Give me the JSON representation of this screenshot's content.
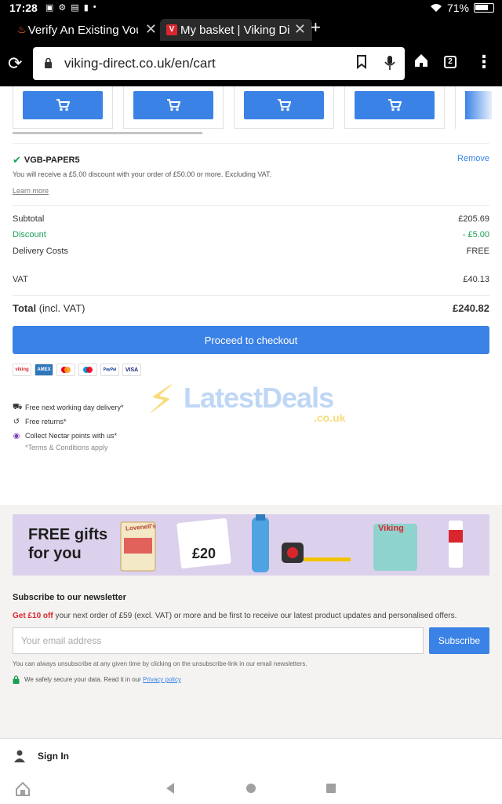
{
  "status_bar": {
    "time": "17:28",
    "battery": "71%"
  },
  "tabs": [
    {
      "title": "Verify An Existing Vouc"
    },
    {
      "title": "My basket | Viking Dire"
    }
  ],
  "toolbar": {
    "url": "viking-direct.co.uk/en/cart",
    "tab_count": "2"
  },
  "promo": {
    "code": "VGB-PAPER5",
    "remove_label": "Remove",
    "description": "You will receive a £5.00 discount with your order of £50.00 or more. Excluding VAT.",
    "learn_more": "Learn more"
  },
  "totals": {
    "subtotal_label": "Subtotal",
    "subtotal": "£205.69",
    "discount_label": "Discount",
    "discount": "- £5.00",
    "delivery_label": "Delivery Costs",
    "delivery": "FREE",
    "vat_label": "VAT",
    "vat": "£40.13",
    "total_label": "Total",
    "total_suffix": "(incl. VAT)",
    "total": "£240.82"
  },
  "checkout_label": "Proceed to checkout",
  "payment_methods": [
    "viking",
    "AMEX",
    "mastercard",
    "maestro",
    "PayPal",
    "VISA"
  ],
  "benefits": [
    {
      "icon": "truck-icon",
      "text": "Free next working day delivery*"
    },
    {
      "icon": "return-icon",
      "text": "Free returns*"
    },
    {
      "icon": "nectar-icon",
      "text": "Collect Nectar points with us*"
    }
  ],
  "terms": "*Terms & Conditions apply",
  "watermark": {
    "name": "LatestDeals",
    "domain": ".co.uk"
  },
  "banner": {
    "line1": "FREE gifts",
    "line2": "for you",
    "card_value": "£20",
    "product_brand": "Viking",
    "box_text": "Lovenell's"
  },
  "newsletter": {
    "title": "Subscribe to our newsletter",
    "offer": "Get £10 off",
    "desc": " your next order of £59 (excl. VAT) or more and be first to receive our latest product updates and personalised offers.",
    "email_placeholder": "Your email address",
    "subscribe_label": "Subscribe",
    "note": "You can always unsubscribe at any given time by clicking on the unsubscribe-link in our email newsletters.",
    "secure_text": "We safely secure your data. Read it in our ",
    "privacy_link": "Privacy policy"
  },
  "signin_label": "Sign In",
  "colors": {
    "accent": "#3b82e6",
    "discount": "#1a9e55",
    "offer": "#d9262e",
    "banner": "#dcd1ec"
  }
}
